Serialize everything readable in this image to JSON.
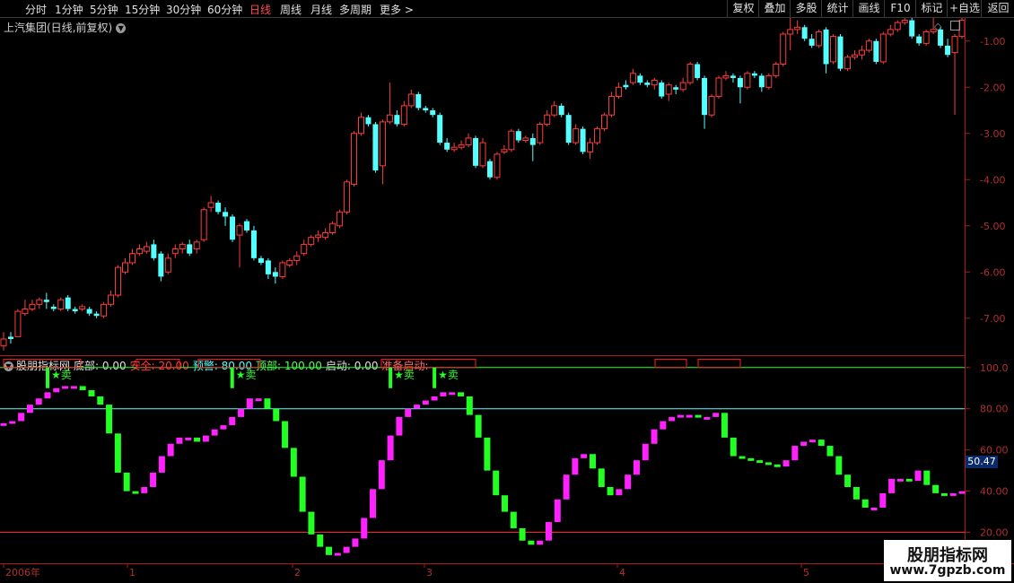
{
  "toolbar": {
    "timeframes": [
      "分时",
      "1分钟",
      "5分钟",
      "15分钟",
      "30分钟",
      "60分钟",
      "日线",
      "周线",
      "月线",
      "多周期",
      "更多 >"
    ],
    "active_timeframe": "日线",
    "right_buttons": [
      "复权",
      "叠加",
      "多股",
      "统计",
      "画线",
      "F10",
      "标记",
      "+自选",
      "返回"
    ]
  },
  "main_chart": {
    "title": "上汽集团(日线,前复权)",
    "y_ticks": [
      "-1.00",
      "-2.00",
      "-3.00",
      "-4.00",
      "-5.00",
      "-6.00",
      "-7.00"
    ],
    "colors": {
      "up": "#ff3c3c",
      "down": "#54ffff"
    }
  },
  "indicator": {
    "name": "股朋指标网",
    "labels": [
      {
        "text": "底部: 0.00",
        "color": "#e0e0e0"
      },
      {
        "text": "安全: 20.00",
        "color": "#ff3c3c"
      },
      {
        "text": "预警: 80.00",
        "color": "#54ffff"
      },
      {
        "text": "顶部: 100.00",
        "color": "#54ff54"
      },
      {
        "text": "启动: 0.00",
        "color": "#e0e0e0"
      },
      {
        "text": "准备启动:",
        "color": "#ff6a6a"
      }
    ],
    "y_ticks": [
      "100.0",
      "80.00",
      "60.00",
      "40.00",
      "20.00"
    ],
    "last_value": "50.47",
    "sell_label": "★卖",
    "colors": {
      "rise": "#ff22ff",
      "fall": "#22ff22"
    }
  },
  "time_axis": {
    "labels": [
      "2006年",
      "1",
      "2",
      "3",
      "4",
      "5"
    ]
  },
  "watermark": {
    "line1": "股朋指标网",
    "line2": "www.7gpzb.com"
  },
  "chart_data": [
    {
      "type": "candlestick",
      "title": "上汽集团(日线,前复权)",
      "ylim": [
        -7.8,
        -0.5
      ],
      "y_ticks": [
        -1,
        -2,
        -3,
        -4,
        -5,
        -6,
        -7
      ],
      "ohlc": [
        [
          -7.6,
          -7.45,
          -7.7,
          -7.3
        ],
        [
          -7.4,
          -7.45,
          -7.55,
          -7.3
        ],
        [
          -7.4,
          -6.85,
          -7.4,
          -6.8
        ],
        [
          -6.9,
          -6.8,
          -6.95,
          -6.6
        ],
        [
          -6.8,
          -6.7,
          -6.85,
          -6.6
        ],
        [
          -6.7,
          -6.6,
          -6.8,
          -6.55
        ],
        [
          -6.6,
          -6.65,
          -6.8,
          -6.45
        ],
        [
          -6.75,
          -6.8,
          -6.85,
          -6.7
        ],
        [
          -6.8,
          -6.6,
          -6.85,
          -6.55
        ],
        [
          -6.55,
          -6.8,
          -6.85,
          -6.5
        ],
        [
          -6.8,
          -6.85,
          -6.9,
          -6.75
        ],
        [
          -6.8,
          -6.75,
          -6.85,
          -6.7
        ],
        [
          -6.8,
          -6.9,
          -6.95,
          -6.75
        ],
        [
          -6.9,
          -6.95,
          -7.0,
          -6.85
        ],
        [
          -6.95,
          -6.7,
          -7.0,
          -6.65
        ],
        [
          -6.7,
          -6.5,
          -6.75,
          -6.4
        ],
        [
          -6.5,
          -5.9,
          -6.55,
          -5.85
        ],
        [
          -6.0,
          -5.8,
          -6.05,
          -5.7
        ],
        [
          -5.8,
          -5.6,
          -5.85,
          -5.5
        ],
        [
          -5.6,
          -5.5,
          -5.65,
          -5.4
        ],
        [
          -5.55,
          -5.45,
          -5.6,
          -5.35
        ],
        [
          -5.4,
          -5.7,
          -5.75,
          -5.3
        ],
        [
          -5.6,
          -6.1,
          -6.2,
          -5.55
        ],
        [
          -6.0,
          -5.7,
          -6.05,
          -5.6
        ],
        [
          -5.6,
          -5.5,
          -5.7,
          -5.4
        ],
        [
          -5.5,
          -5.4,
          -5.6,
          -5.35
        ],
        [
          -5.4,
          -5.6,
          -5.65,
          -5.3
        ],
        [
          -5.5,
          -5.35,
          -5.6,
          -5.3
        ],
        [
          -5.3,
          -4.65,
          -5.35,
          -4.6
        ],
        [
          -4.6,
          -4.5,
          -4.7,
          -4.35
        ],
        [
          -4.5,
          -4.7,
          -4.75,
          -4.45
        ],
        [
          -4.7,
          -4.8,
          -5.0,
          -4.6
        ],
        [
          -4.8,
          -5.3,
          -5.35,
          -4.75
        ],
        [
          -5.2,
          -5.0,
          -5.9,
          -4.95
        ],
        [
          -4.9,
          -5.1,
          -5.15,
          -4.85
        ],
        [
          -5.1,
          -5.7,
          -5.75,
          -5.0
        ],
        [
          -5.7,
          -5.8,
          -5.85,
          -5.65
        ],
        [
          -5.75,
          -6.05,
          -6.15,
          -5.7
        ],
        [
          -6.0,
          -6.1,
          -6.25,
          -5.9
        ],
        [
          -6.1,
          -5.8,
          -6.15,
          -5.75
        ],
        [
          -5.85,
          -5.75,
          -5.9,
          -5.7
        ],
        [
          -5.75,
          -5.65,
          -5.85,
          -5.55
        ],
        [
          -5.6,
          -5.4,
          -5.65,
          -5.3
        ],
        [
          -5.4,
          -5.25,
          -5.45,
          -5.2
        ],
        [
          -5.25,
          -5.2,
          -5.35,
          -5.1
        ],
        [
          -5.25,
          -5.15,
          -5.3,
          -5.05
        ],
        [
          -5.15,
          -4.95,
          -5.2,
          -4.9
        ],
        [
          -5.0,
          -4.7,
          -5.05,
          -4.65
        ],
        [
          -4.7,
          -4.05,
          -4.75,
          -4.0
        ],
        [
          -4.1,
          -3.0,
          -4.15,
          -2.95
        ],
        [
          -3.0,
          -2.65,
          -3.05,
          -2.55
        ],
        [
          -2.65,
          -2.8,
          -2.85,
          -2.6
        ],
        [
          -2.8,
          -3.8,
          -3.85,
          -2.75
        ],
        [
          -3.7,
          -2.75,
          -4.1,
          -2.7
        ],
        [
          -2.75,
          -2.6,
          -2.8,
          -1.9
        ],
        [
          -2.6,
          -2.8,
          -2.85,
          -2.5
        ],
        [
          -2.8,
          -2.4,
          -2.85,
          -2.3
        ],
        [
          -2.4,
          -2.15,
          -2.45,
          -2.05
        ],
        [
          -2.15,
          -2.45,
          -2.5,
          -2.1
        ],
        [
          -2.45,
          -2.5,
          -2.55,
          -2.4
        ],
        [
          -2.5,
          -2.6,
          -2.65,
          -2.45
        ],
        [
          -2.6,
          -3.2,
          -3.25,
          -2.55
        ],
        [
          -3.2,
          -3.35,
          -3.4,
          -3.1
        ],
        [
          -3.35,
          -3.3,
          -3.4,
          -3.2
        ],
        [
          -3.3,
          -3.25,
          -3.35,
          -3.15
        ],
        [
          -3.25,
          -3.1,
          -3.3,
          -3.0
        ],
        [
          -3.1,
          -3.7,
          -3.75,
          -3.05
        ],
        [
          -3.7,
          -3.2,
          -3.75,
          -3.1
        ],
        [
          -3.6,
          -3.95,
          -4.0,
          -3.55
        ],
        [
          -3.95,
          -3.45,
          -4.0,
          -3.4
        ],
        [
          -3.4,
          -3.35,
          -3.45,
          -3.25
        ],
        [
          -3.35,
          -2.95,
          -3.4,
          -2.9
        ],
        [
          -2.95,
          -3.15,
          -3.2,
          -2.9
        ],
        [
          -3.15,
          -3.1,
          -3.2,
          -3.05
        ],
        [
          -3.1,
          -3.25,
          -3.6,
          -3.0
        ],
        [
          -3.2,
          -2.8,
          -3.25,
          -2.75
        ],
        [
          -2.8,
          -2.6,
          -2.85,
          -2.5
        ],
        [
          -2.6,
          -2.4,
          -2.65,
          -2.3
        ],
        [
          -2.4,
          -2.6,
          -2.65,
          -2.35
        ],
        [
          -2.6,
          -3.2,
          -3.25,
          -2.55
        ],
        [
          -3.2,
          -2.9,
          -3.25,
          -2.8
        ],
        [
          -2.9,
          -3.4,
          -3.45,
          -2.85
        ],
        [
          -3.4,
          -3.2,
          -3.55,
          -3.1
        ],
        [
          -3.2,
          -2.9,
          -3.25,
          -2.85
        ],
        [
          -2.9,
          -2.6,
          -2.95,
          -2.55
        ],
        [
          -2.6,
          -2.2,
          -2.65,
          -2.1
        ],
        [
          -2.2,
          -2.0,
          -2.25,
          -1.9
        ],
        [
          -1.95,
          -2.0,
          -2.05,
          -1.85
        ],
        [
          -1.9,
          -1.7,
          -1.95,
          -1.6
        ],
        [
          -1.75,
          -1.9,
          -1.95,
          -1.7
        ],
        [
          -1.9,
          -1.95,
          -2.0,
          -1.85
        ],
        [
          -1.95,
          -1.85,
          -2.05,
          -1.8
        ],
        [
          -1.9,
          -2.2,
          -2.25,
          -1.85
        ],
        [
          -2.15,
          -1.95,
          -2.3,
          -1.9
        ],
        [
          -2.0,
          -2.05,
          -2.15,
          -1.95
        ],
        [
          -2.05,
          -1.9,
          -2.1,
          -1.8
        ],
        [
          -1.9,
          -1.5,
          -1.95,
          -1.45
        ],
        [
          -1.5,
          -1.8,
          -1.85,
          -1.45
        ],
        [
          -1.8,
          -2.6,
          -2.9,
          -1.75
        ],
        [
          -2.6,
          -2.2,
          -2.65,
          -2.15
        ],
        [
          -2.2,
          -1.8,
          -2.25,
          -1.75
        ],
        [
          -1.8,
          -1.75,
          -1.85,
          -1.65
        ],
        [
          -1.75,
          -1.8,
          -1.9,
          -1.7
        ],
        [
          -1.8,
          -2.0,
          -2.35,
          -1.75
        ],
        [
          -2.0,
          -1.7,
          -2.05,
          -1.65
        ],
        [
          -1.7,
          -1.75,
          -1.8,
          -1.65
        ],
        [
          -1.75,
          -2.0,
          -2.1,
          -1.7
        ],
        [
          -2.0,
          -1.75,
          -2.05,
          -1.7
        ],
        [
          -1.75,
          -1.5,
          -1.8,
          -1.45
        ],
        [
          -1.5,
          -0.85,
          -1.55,
          -0.8
        ],
        [
          -0.85,
          -0.75,
          -1.2,
          -0.4
        ],
        [
          -0.75,
          -0.7,
          -0.85,
          -0.55
        ],
        [
          -0.7,
          -0.95,
          -1.0,
          -0.65
        ],
        [
          -0.95,
          -1.1,
          -1.15,
          -0.85
        ],
        [
          -1.1,
          -0.8,
          -1.15,
          -0.75
        ],
        [
          -0.75,
          -1.5,
          -1.7,
          -0.7
        ],
        [
          -1.45,
          -0.9,
          -1.5,
          -0.85
        ],
        [
          -0.9,
          -1.6,
          -1.65,
          -0.85
        ],
        [
          -1.6,
          -1.35,
          -1.65,
          -1.3
        ],
        [
          -1.35,
          -1.3,
          -1.4,
          -1.2
        ],
        [
          -1.3,
          -1.2,
          -1.4,
          -1.1
        ],
        [
          -1.2,
          -1.0,
          -1.25,
          -0.95
        ],
        [
          -1.0,
          -1.45,
          -1.5,
          -0.95
        ],
        [
          -1.45,
          -0.85,
          -1.5,
          -0.8
        ],
        [
          -0.85,
          -0.75,
          -0.9,
          -0.65
        ],
        [
          -0.75,
          -0.6,
          -0.8,
          -0.55
        ],
        [
          -0.6,
          -0.55,
          -0.65,
          -0.35
        ],
        [
          -0.55,
          -0.9,
          -0.95,
          -0.5
        ],
        [
          -0.9,
          -1.05,
          -1.1,
          -0.85
        ],
        [
          -1.05,
          -0.8,
          -1.1,
          -0.75
        ],
        [
          -0.8,
          -0.75,
          -0.85,
          -0.35
        ],
        [
          -0.75,
          -1.1,
          -1.15,
          -0.7
        ],
        [
          -1.1,
          -1.3,
          -1.35,
          -0.95
        ],
        [
          -1.25,
          -0.9,
          -2.6,
          -0.85
        ],
        [
          -0.9,
          -0.55,
          -0.95,
          -0.45
        ]
      ]
    },
    {
      "type": "bar",
      "title": "股朋指标网",
      "ylim": [
        5,
        106
      ],
      "reference_lines": [
        100,
        80,
        20
      ],
      "sell_signals": [
        5,
        26,
        44,
        49
      ],
      "values": [
        73,
        74,
        78,
        82,
        85,
        88,
        90,
        91,
        91,
        89,
        86,
        82,
        68,
        49,
        40,
        39,
        42,
        49,
        57,
        63,
        66,
        66,
        64,
        67,
        70,
        72,
        76,
        80,
        85,
        85,
        80,
        74,
        61,
        47,
        30,
        19,
        13,
        9,
        10,
        13,
        17,
        27,
        41,
        55,
        67,
        76,
        80,
        82,
        84,
        86,
        88,
        88,
        86,
        77,
        66,
        50,
        38,
        30,
        22,
        16,
        14,
        16,
        25,
        36,
        48,
        56,
        58,
        51,
        42,
        38,
        41,
        48,
        55,
        63,
        70,
        74,
        76,
        77,
        77,
        76,
        76,
        78,
        66,
        57,
        56,
        55,
        54,
        53,
        52,
        55,
        62,
        64,
        65,
        62,
        57,
        48,
        42,
        36,
        32,
        32,
        39,
        46,
        46,
        45,
        50,
        43,
        39,
        38,
        39,
        40
      ]
    }
  ]
}
